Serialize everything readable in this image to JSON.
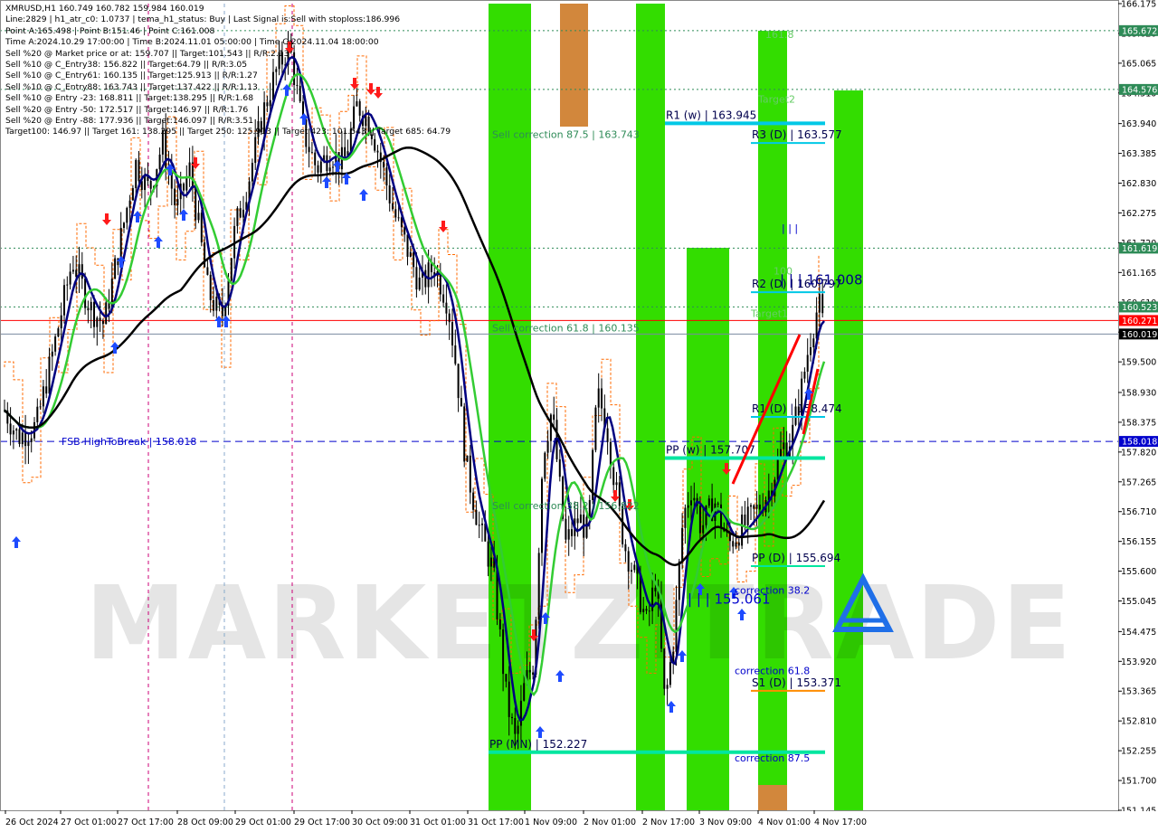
{
  "info_lines": [
    "XMRUSD,H1  160.749 160.782 159.984 160.019",
    "Line:2829  |  h1_atr_c0: 1.0737  |  tema_h1_status: Buy  |  Last Signal is:Sell with stoploss:186.996",
    "Point A:165.498  |  Point B:151.46  |  Point C:161.008",
    "Time A:2024.10.29 17:00:00  |  Time B:2024.11.01 05:00:00  |  Time C:2024.11.04 18:00:00",
    "Sell %20 @ Market price or at: 159.707  ||  Target:101.543  ||  R/R:2.13",
    "Sell %10 @ C_Entry38: 156.822  ||  Target:64.79  ||  R/R:3.05",
    "Sell %10 @ C_Entry61: 160.135  ||  Target:125.913  ||  R/R:1.27",
    "Sell %10 @ C_Entry88: 163.743  ||  Target:137.422  ||  R/R:1.13",
    "Sell %10 @ Entry -23: 168.811  ||  Target:138.295  ||  R/R:1.68",
    "Sell %20 @ Entry -50: 172.517  ||  Target:146.97  ||  R/R:1.76",
    "Sell %20 @ Entry -88: 177.936  ||  Target:146.097  ||  R/R:3.51",
    "Target100: 146.97  ||  Target 161: 138.295  ||  Target 250: 125.913  ||  Target 423: 101.543  ||  Target 685: 64.79"
  ],
  "watermark": "MARKETZITRADE",
  "colors": {
    "green_band": "#33dd00",
    "orange_band": "#d2873c",
    "ma_navy": "#000080",
    "ma_green": "#33cc33",
    "ma_black": "#000000",
    "level_cyan": "#00c8e6",
    "level_teal": "#00e6a0",
    "red": "#ff0000",
    "blue_dash": "#0000cc",
    "candle": "#000000",
    "orange_dash": "#ff6a00",
    "magenta_dash": "#cc0077"
  },
  "chart_data": {
    "type": "candlestick",
    "symbol": "XMRUSD,H1",
    "ylim": [
      151.145,
      166.175
    ],
    "price_ticks": [
      "166.175",
      "165.620",
      "165.065",
      "164.510",
      "163.940",
      "163.385",
      "162.830",
      "162.275",
      "161.720",
      "161.165",
      "160.610",
      "160.055",
      "159.500",
      "158.930",
      "158.375",
      "157.820",
      "157.265",
      "156.710",
      "156.155",
      "155.600",
      "155.045",
      "154.475",
      "153.920",
      "153.365",
      "152.810",
      "152.255",
      "151.700",
      "151.145"
    ],
    "time_ticks": [
      "26 Oct 2024",
      "27 Oct 01:00",
      "27 Oct 17:00",
      "28 Oct 09:00",
      "29 Oct 01:00",
      "29 Oct 17:00",
      "30 Oct 09:00",
      "31 Oct 01:00",
      "31 Oct 17:00",
      "1 Nov 09:00",
      "2 Nov 01:00",
      "2 Nov 17:00",
      "3 Nov 09:00",
      "4 Nov 01:00",
      "4 Nov 17:00"
    ],
    "price_badges": [
      {
        "text": "165.672",
        "price": 165.672,
        "bg": "#2e8b57",
        "fg": "#ffffff"
      },
      {
        "text": "164.576",
        "price": 164.576,
        "bg": "#2e8b57",
        "fg": "#ffffff"
      },
      {
        "text": "161.619",
        "price": 161.619,
        "bg": "#2e8b57",
        "fg": "#ffffff"
      },
      {
        "text": "160.523",
        "price": 160.523,
        "bg": "#2e8b57",
        "fg": "#ffffff"
      },
      {
        "text": "160.271",
        "price": 160.271,
        "bg": "#ff0000",
        "fg": "#ffffff"
      },
      {
        "text": "160.019",
        "price": 160.019,
        "bg": "#000000",
        "fg": "#ffffff"
      },
      {
        "text": "158.018",
        "price": 158.018,
        "bg": "#0000cc",
        "fg": "#ffffff"
      }
    ],
    "horizontal_lines": [
      {
        "price": 165.672,
        "color": "#2e8b57",
        "dash": "2,3"
      },
      {
        "price": 164.576,
        "color": "#2e8b57",
        "dash": "2,3"
      },
      {
        "price": 161.619,
        "color": "#2e8b57",
        "dash": "2,3"
      },
      {
        "price": 160.523,
        "color": "#2e8b57",
        "dash": "2,3"
      },
      {
        "price": 160.271,
        "color": "#ff0000",
        "dash": ""
      },
      {
        "price": 160.019,
        "color": "#7a8aa0",
        "dash": ""
      },
      {
        "price": 158.018,
        "color": "#0000cc",
        "dash": "8,5"
      }
    ],
    "level_lines": [
      {
        "label": "R1 (w) | 163.945",
        "price": 163.945,
        "color": "#00c8e6"
      },
      {
        "label": "R3 (D) | 163.577",
        "price": 163.577,
        "color": "#00c8e6"
      },
      {
        "label": "R2 (D) | 160.797",
        "price": 160.797,
        "color": "#00c8e6"
      },
      {
        "label": "R1 (D) | 158.474",
        "price": 158.474,
        "color": "#00c8e6"
      },
      {
        "label": "PP (w) | 157.707",
        "price": 157.707,
        "color": "#00e6a0"
      },
      {
        "label": "PP (D) | 155.694",
        "price": 155.694,
        "color": "#00e6a0"
      },
      {
        "label": "S1 (D) | 153.371",
        "price": 153.371,
        "color": "#ff8c00"
      },
      {
        "label": "PP (MN) | 152.227",
        "price": 152.227,
        "color": "#00e6a0"
      }
    ],
    "annotations": [
      {
        "text": "161.8",
        "price": 165.6,
        "color": "#66cc66"
      },
      {
        "text": "Target2",
        "price": 164.4,
        "color": "#66cc66"
      },
      {
        "text": "Sell correction 87.5 | 163.743",
        "price": 163.743,
        "color": "#2e8b57"
      },
      {
        "text": "| | | 161.008",
        "price": 161.008,
        "color": "#00008b"
      },
      {
        "text": "| | |",
        "price": 162.0,
        "color": "#0000cc"
      },
      {
        "text": "100",
        "price": 161.2,
        "color": "#66cc66"
      },
      {
        "text": "Target1",
        "price": 160.4,
        "color": "#66cc66"
      },
      {
        "text": "Sell correction 61.8 | 160.135",
        "price": 160.135,
        "color": "#2e8b57"
      },
      {
        "text": "FSB-HighToBreak | 158.018",
        "price": 158.018,
        "color": "#0000cc"
      },
      {
        "text": "Sell correction 38.2 | 156.822",
        "price": 156.822,
        "color": "#2e8b57"
      },
      {
        "text": "correction 38.2",
        "price": 155.25,
        "color": "#0000cc"
      },
      {
        "text": "| | | 155.061",
        "price": 155.061,
        "color": "#0000cc"
      },
      {
        "text": "correction 61.8",
        "price": 153.75,
        "color": "#0000cc"
      },
      {
        "text": "correction 87.5",
        "price": 152.12,
        "color": "#0000cc"
      }
    ]
  }
}
